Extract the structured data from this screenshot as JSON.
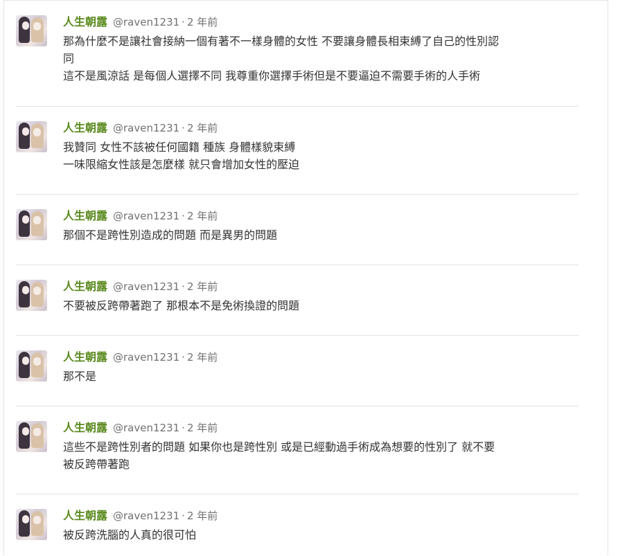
{
  "comments": [
    {
      "author": "人生朝露",
      "handle": "@raven1231",
      "separator": "·",
      "time": "2 年前",
      "lines": [
        "那為什麼不是讓社會接納一個有著不一樣身體的女性 不要讓身體長相束縛了自己的性別認",
        "同",
        "這不是風涼話 是每個人選擇不同 我尊重你選擇手術但是不要逼迫不需要手術的人手術"
      ]
    },
    {
      "author": "人生朝露",
      "handle": "@raven1231",
      "separator": "·",
      "time": "2 年前",
      "lines": [
        "我贊同 女性不該被任何國籍 種族 身體樣貌束縛",
        "一味限縮女性該是怎麼樣 就只會增加女性的壓迫"
      ]
    },
    {
      "author": "人生朝露",
      "handle": "@raven1231",
      "separator": "·",
      "time": "2 年前",
      "lines": [
        "那個不是跨性別造成的問題 而是異男的問題"
      ]
    },
    {
      "author": "人生朝露",
      "handle": "@raven1231",
      "separator": "·",
      "time": "2 年前",
      "lines": [
        "不要被反跨帶著跑了 那根本不是免術換證的問題"
      ]
    },
    {
      "author": "人生朝露",
      "handle": "@raven1231",
      "separator": "·",
      "time": "2 年前",
      "lines": [
        "那不是"
      ]
    },
    {
      "author": "人生朝露",
      "handle": "@raven1231",
      "separator": "·",
      "time": "2 年前",
      "lines": [
        "這些不是跨性別者的問題 如果你也是跨性別 或是已經動過手術成為想要的性別了 就不要",
        "被反跨帶著跑"
      ]
    },
    {
      "author": "人生朝露",
      "handle": "@raven1231",
      "separator": "·",
      "time": "2 年前",
      "lines": [
        "被反跨洗腦的人真的很可怕"
      ]
    }
  ],
  "colors": {
    "author": "#5a8a1e",
    "meta": "#707070",
    "text": "#333333",
    "divider": "#e2e2e2"
  }
}
